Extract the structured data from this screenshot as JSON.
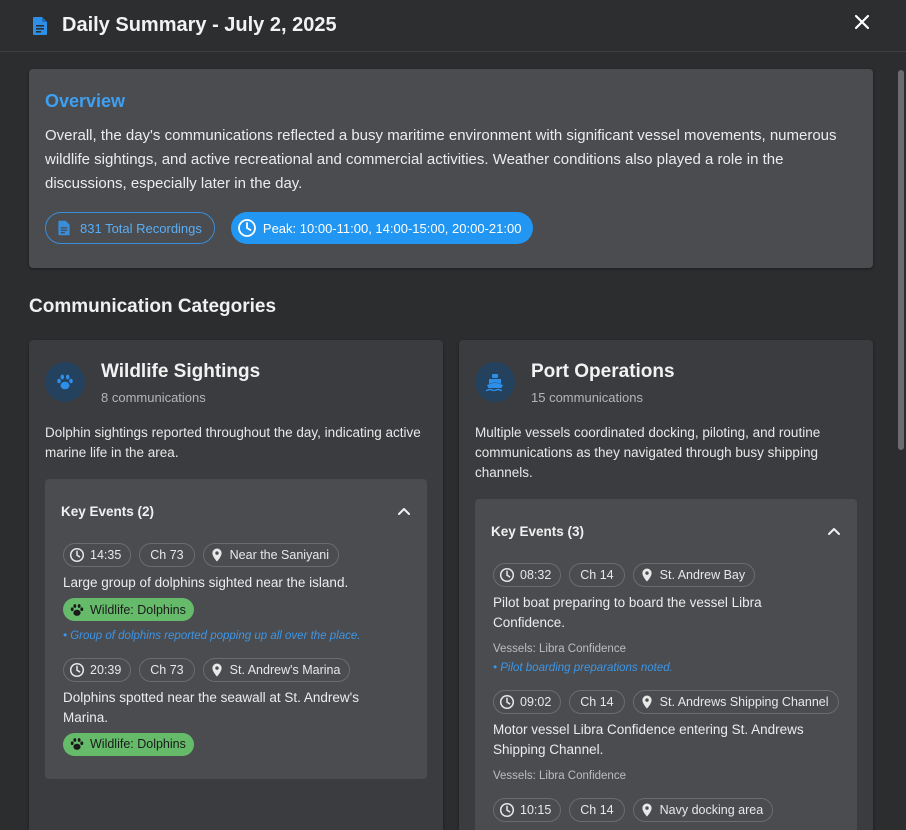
{
  "header": {
    "title": "Daily Summary - July 2, 2025",
    "icon": "document-icon",
    "close_icon": "close-icon"
  },
  "colors": {
    "accent": "#2196f3",
    "wildlife_tag": "#66bb6a",
    "note": "#3d95e6"
  },
  "overview": {
    "heading": "Overview",
    "text": "Overall, the day's communications reflected a busy maritime environment with significant vessel movements, numerous wildlife sightings, and active recreational and commercial activities. Weather conditions also played a role in the discussions, especially later in the day.",
    "total_recordings": "831 Total Recordings",
    "peak": "Peak: 10:00-11:00, 14:00-15:00, 20:00-21:00"
  },
  "categories_title": "Communication Categories",
  "wildlife": {
    "title": "Wildlife Sightings",
    "count": "8 communications",
    "description": "Dolphin sightings reported throughout the day, indicating active marine life in the area.",
    "key_events_label": "Key Events (2)",
    "events": [
      {
        "time": "14:35",
        "channel": "Ch 73",
        "location": "Near the Saniyani",
        "text": "Large group of dolphins sighted near the island.",
        "tag": "Wildlife: Dolphins",
        "note": "• Group of dolphins reported popping up all over the place."
      },
      {
        "time": "20:39",
        "channel": "Ch 73",
        "location": "St. Andrew's Marina",
        "text": "Dolphins spotted near the seawall at St. Andrew's Marina.",
        "tag": "Wildlife: Dolphins"
      }
    ]
  },
  "port": {
    "title": "Port Operations",
    "count": "15 communications",
    "description": "Multiple vessels coordinated docking, piloting, and routine communications as they navigated through busy shipping channels.",
    "key_events_label": "Key Events (3)",
    "events": [
      {
        "time": "08:32",
        "channel": "Ch 14",
        "location": "St. Andrew Bay",
        "text": "Pilot boat preparing to board the vessel Libra Confidence.",
        "vessels": "Vessels: Libra Confidence",
        "note": "• Pilot boarding preparations noted."
      },
      {
        "time": "09:02",
        "channel": "Ch 14",
        "location": "St. Andrews Shipping Channel",
        "text": "Motor vessel Libra Confidence entering St. Andrews Shipping Channel.",
        "vessels": "Vessels: Libra Confidence"
      },
      {
        "time": "10:15",
        "channel": "Ch 14",
        "location": "Navy docking area"
      }
    ]
  }
}
